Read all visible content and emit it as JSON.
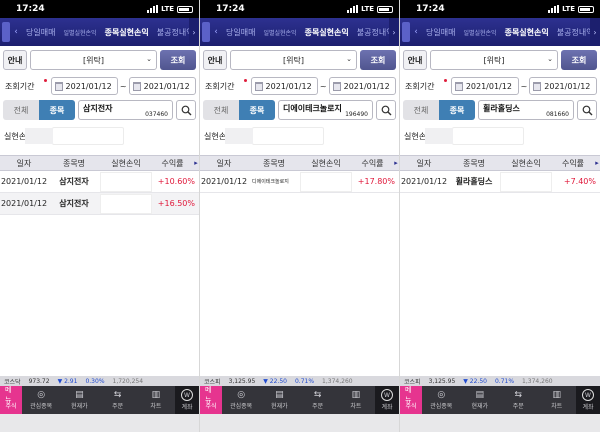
{
  "screens": [
    {
      "status_time": "17:24",
      "status_network": "LTE",
      "tabs": [
        "당일매매",
        "일별실현손익",
        "종목실현손익",
        "불공정내역"
      ],
      "guide_label": "안내",
      "account_select": "[위탁]",
      "query_label": "조회",
      "period_label": "조회기간",
      "date_from": "2021/01/12",
      "date_sep": "~",
      "date_to": "2021/01/12",
      "seg_all": "전체",
      "seg_stock": "종목",
      "stock_name": "삼지전자",
      "stock_code": "037460",
      "realized_sum_label": "실현손익합",
      "columns": [
        "일자",
        "종목명",
        "실현손익",
        "수익률"
      ],
      "rows": [
        {
          "date": "2021/01/12",
          "name": "삼지전자",
          "pl": "",
          "rate": "+10.60%"
        },
        {
          "date": "2021/01/12",
          "name": "삼지전자",
          "pl": "",
          "rate": "+16.50%"
        }
      ],
      "ticker": {
        "name": "코스닥",
        "value": "973.72",
        "change": "▼ 2.91",
        "pct": "0.30%",
        "volume": "1,720,254"
      }
    },
    {
      "status_time": "17:24",
      "status_network": "LTE",
      "tabs": [
        "당일매매",
        "일별실현손익",
        "종목실현손익",
        "불공정내역"
      ],
      "guide_label": "안내",
      "account_select": "[위탁]",
      "query_label": "조회",
      "period_label": "조회기간",
      "date_from": "2021/01/12",
      "date_sep": "~",
      "date_to": "2021/01/12",
      "seg_all": "전체",
      "seg_stock": "종목",
      "stock_name": "디에이테크놀로지",
      "stock_code": "196490",
      "realized_sum_label": "실현손익합",
      "columns": [
        "일자",
        "종목명",
        "실현손익",
        "수익률"
      ],
      "rows": [
        {
          "date": "2021/01/12",
          "name": "디에이테크놀로지",
          "pl": "",
          "rate": "+17.80%"
        }
      ],
      "ticker": {
        "name": "코스피",
        "value": "3,125.95",
        "change": "▼ 22.50",
        "pct": "0.71%",
        "volume": "1,374,260"
      }
    },
    {
      "status_time": "17:24",
      "status_network": "LTE",
      "tabs": [
        "당일매매",
        "일별실현손익",
        "종목실현손익",
        "불공정내역"
      ],
      "guide_label": "안내",
      "account_select": "[위탁]",
      "query_label": "조회",
      "period_label": "조회기간",
      "date_from": "2021/01/12",
      "date_sep": "~",
      "date_to": "2021/01/12",
      "seg_all": "전체",
      "seg_stock": "종목",
      "stock_name": "휠라홀딩스",
      "stock_code": "081660",
      "realized_sum_label": "실현손익합",
      "columns": [
        "일자",
        "종목명",
        "실현손익",
        "수익률"
      ],
      "rows": [
        {
          "date": "2021/01/12",
          "name": "휠라홀딩스",
          "pl": "",
          "rate": "+7.40%"
        }
      ],
      "ticker": {
        "name": "코스피",
        "value": "3,125.95",
        "change": "▼ 22.50",
        "pct": "0.71%",
        "volume": "1,374,260"
      }
    }
  ],
  "nav": [
    "주식",
    "관심종목",
    "현재가",
    "주문",
    "차트",
    "계좌"
  ],
  "nav_menu_label": "메뉴",
  "colors": {
    "tab_bg": "#1c1f6e",
    "accent_blue": "#3f7fb4",
    "positive_red": "#e0183a",
    "menu_pink": "#e6348f"
  }
}
